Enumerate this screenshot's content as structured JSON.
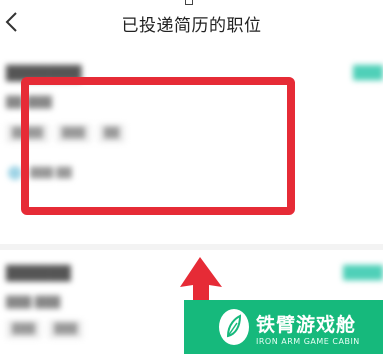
{
  "header": {
    "title": "已投递简历的职位"
  },
  "icons": {
    "back": "chevron-left-icon",
    "logo": "leaf-logo-icon"
  },
  "colors": {
    "highlight": "#e62b36",
    "accent": "#4fd0b8",
    "brand": "#16b97c"
  },
  "watermark": {
    "name": "铁臂游戏舱",
    "subtitle": "IRON ARM GAME CABIN"
  }
}
